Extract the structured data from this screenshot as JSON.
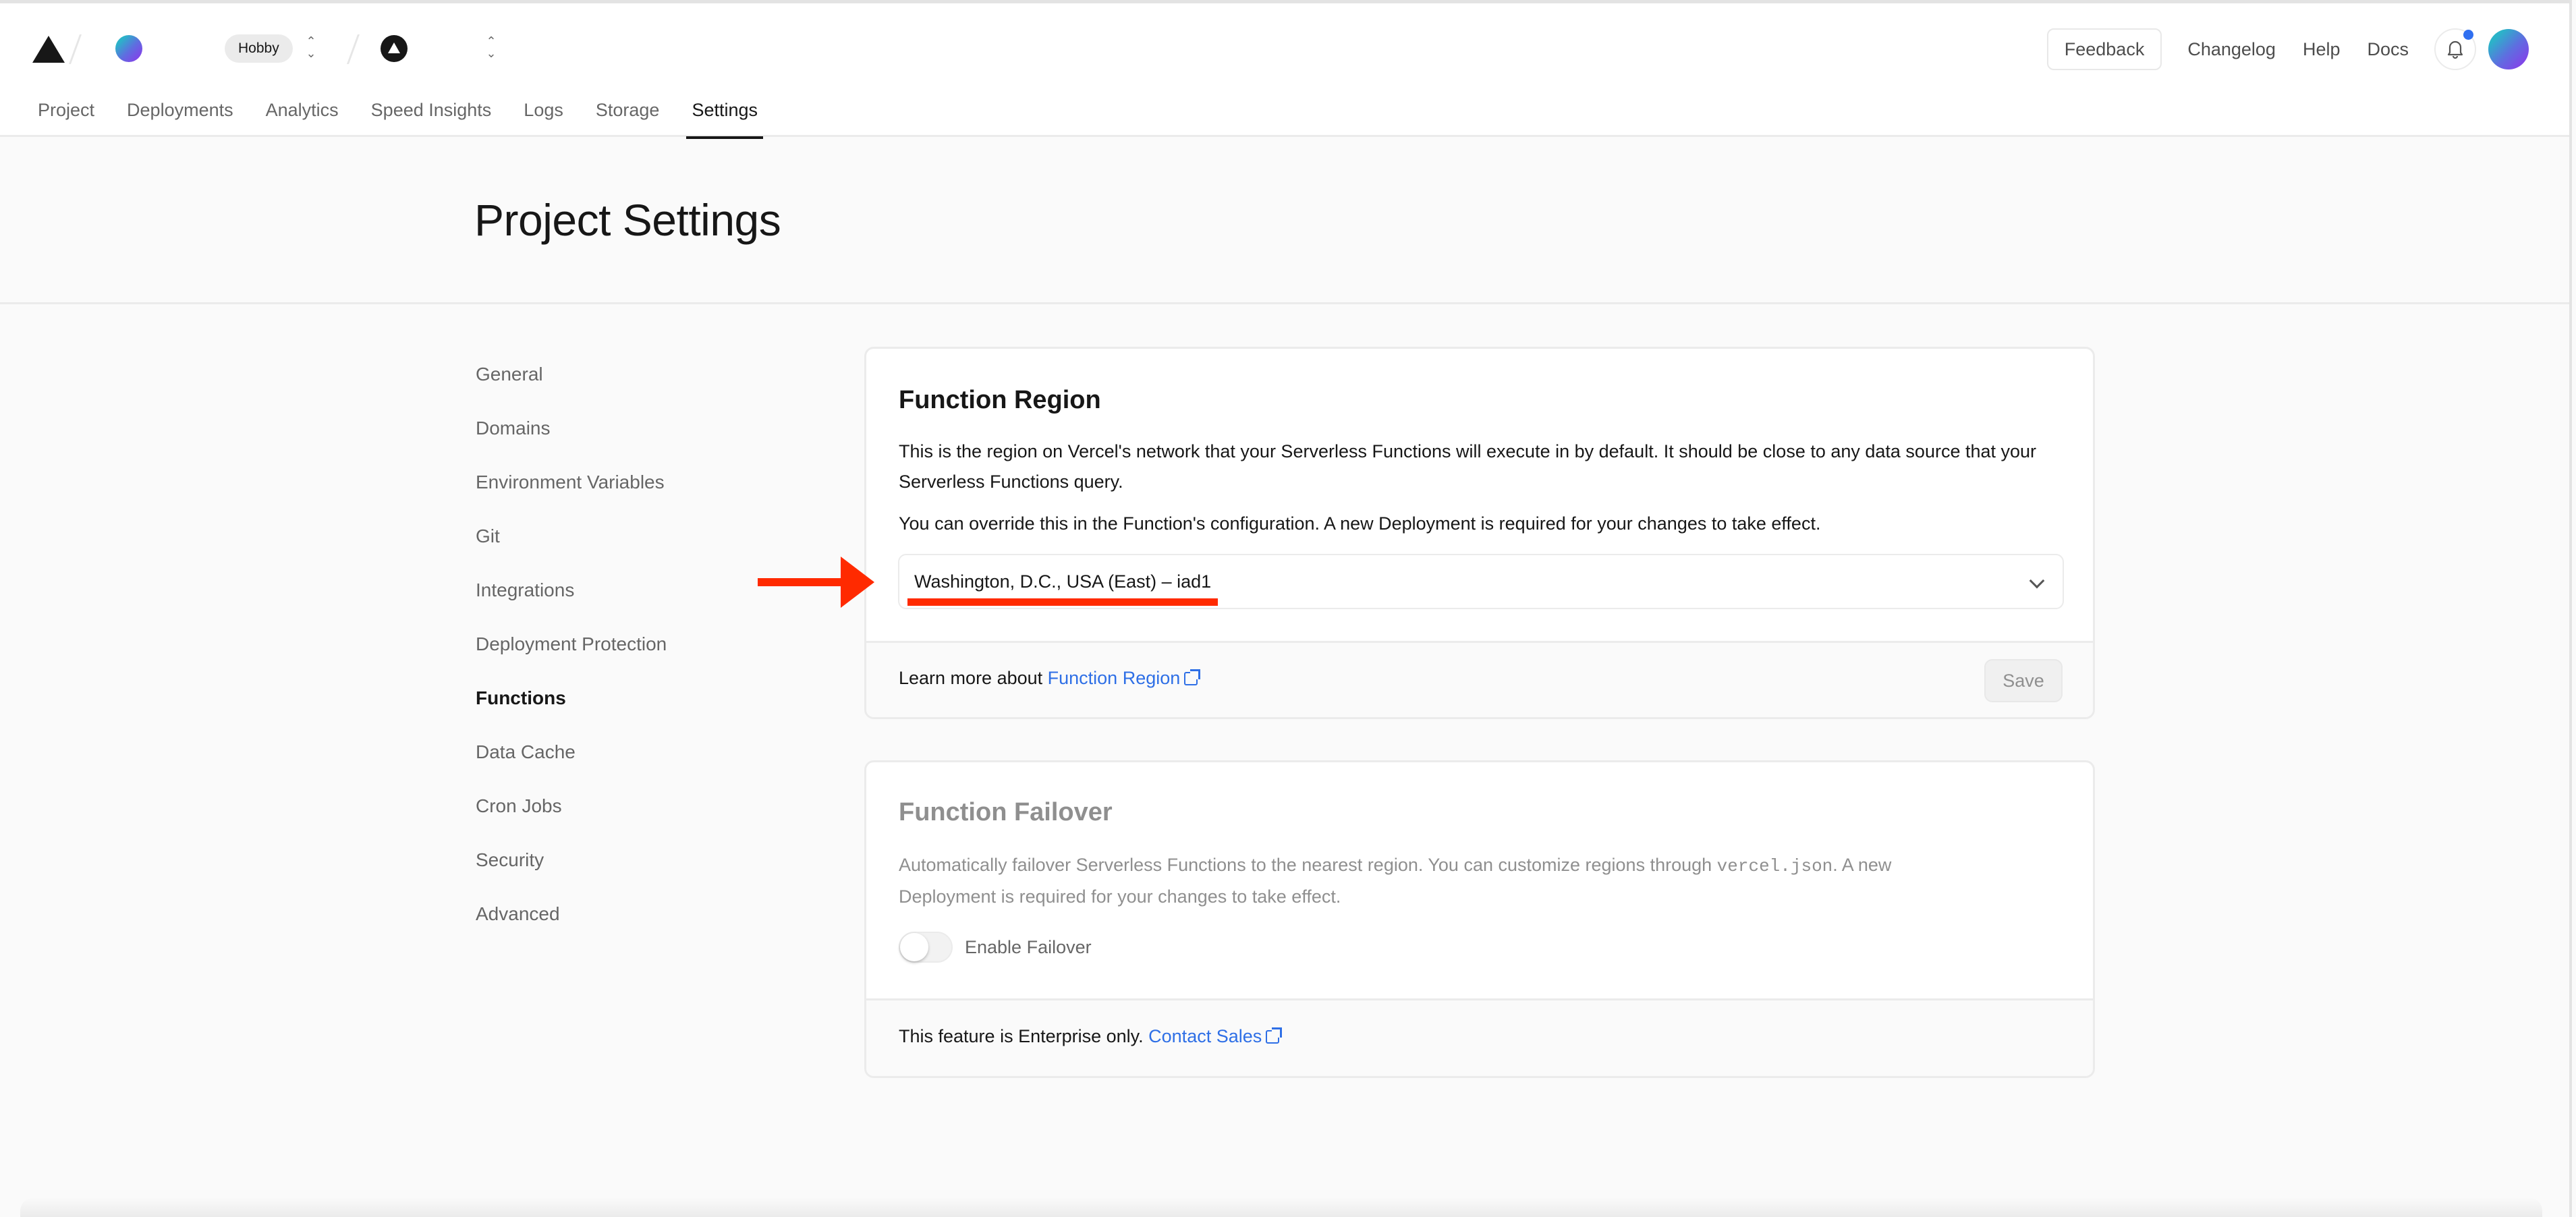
{
  "header": {
    "breadcrumb": {
      "team_name": "",
      "plan_badge": "Hobby",
      "project_name": ""
    },
    "actions": {
      "feedback_label": "Feedback",
      "changelog_label": "Changelog",
      "help_label": "Help",
      "docs_label": "Docs"
    },
    "notifications": {
      "has_unread": true
    },
    "tabs": [
      {
        "label": "Project",
        "active": false
      },
      {
        "label": "Deployments",
        "active": false
      },
      {
        "label": "Analytics",
        "active": false
      },
      {
        "label": "Speed Insights",
        "active": false
      },
      {
        "label": "Logs",
        "active": false
      },
      {
        "label": "Storage",
        "active": false
      },
      {
        "label": "Settings",
        "active": true
      }
    ]
  },
  "page": {
    "title": "Project Settings"
  },
  "sidebar": {
    "items": [
      {
        "label": "General"
      },
      {
        "label": "Domains"
      },
      {
        "label": "Environment Variables"
      },
      {
        "label": "Git"
      },
      {
        "label": "Integrations"
      },
      {
        "label": "Deployment Protection"
      },
      {
        "label": "Functions",
        "active": true
      },
      {
        "label": "Data Cache"
      },
      {
        "label": "Cron Jobs"
      },
      {
        "label": "Security"
      },
      {
        "label": "Advanced"
      }
    ]
  },
  "function_region": {
    "title": "Function Region",
    "description": "This is the region on Vercel's network that your Serverless Functions will execute in by default. It should be close to any data source that your Serverless Functions query.",
    "override_note": "You can override this in the Function's configuration. A new Deployment is required for your changes to take effect.",
    "selected_region": "Washington, D.C., USA (East) – iad1",
    "footer_prefix": "Learn more about ",
    "footer_link": "Function Region",
    "save_label": "Save",
    "save_disabled": true
  },
  "function_failover": {
    "title": "Function Failover",
    "description_before": "Automatically failover Serverless Functions to the nearest region. You can customize regions through ",
    "description_code": "vercel.json",
    "description_after": ". A new Deployment is required for your changes to take effect.",
    "toggle_label": "Enable Failover",
    "toggle_on": false,
    "footer_prefix": "This feature is Enterprise only. ",
    "footer_link": "Contact Sales"
  },
  "annotations": {
    "arrow_color": "#ff2a00",
    "target": "region-select"
  },
  "colors": {
    "accent_link": "#2e6fe6",
    "notification_dot": "#2f6ff0",
    "text_primary": "#171717",
    "text_muted": "#666666"
  }
}
